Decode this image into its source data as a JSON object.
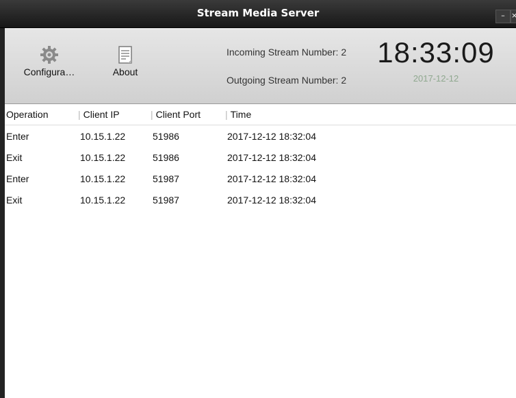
{
  "window": {
    "title": "Stream Media Server",
    "minimize_glyph": "–",
    "close_glyph": "×"
  },
  "toolbar": {
    "config": {
      "label": "Configura…",
      "icon": "gear-icon"
    },
    "about": {
      "label": "About",
      "icon": "document-icon"
    }
  },
  "stats": {
    "incoming_label": "Incoming Stream Number:",
    "incoming_value": "2",
    "outgoing_label": "Outgoing Stream Number:",
    "outgoing_value": "2",
    "clock": "18:33:09",
    "date": "2017-12-12"
  },
  "table": {
    "columns": [
      "Operation",
      "Client IP",
      "Client Port",
      "Time"
    ],
    "rows": [
      {
        "operation": "Enter",
        "ip": "10.15.1.22",
        "port": "51986",
        "time": "2017-12-12 18:32:04"
      },
      {
        "operation": "Exit",
        "ip": "10.15.1.22",
        "port": "51986",
        "time": "2017-12-12 18:32:04"
      },
      {
        "operation": "Enter",
        "ip": "10.15.1.22",
        "port": "51987",
        "time": "2017-12-12 18:32:04"
      },
      {
        "operation": "Exit",
        "ip": "10.15.1.22",
        "port": "51987",
        "time": "2017-12-12 18:32:04"
      }
    ]
  },
  "colors": {
    "titlebar": "#1f1f1f",
    "toolbar": "#dcdcdc",
    "date_text": "#8fa88f"
  }
}
